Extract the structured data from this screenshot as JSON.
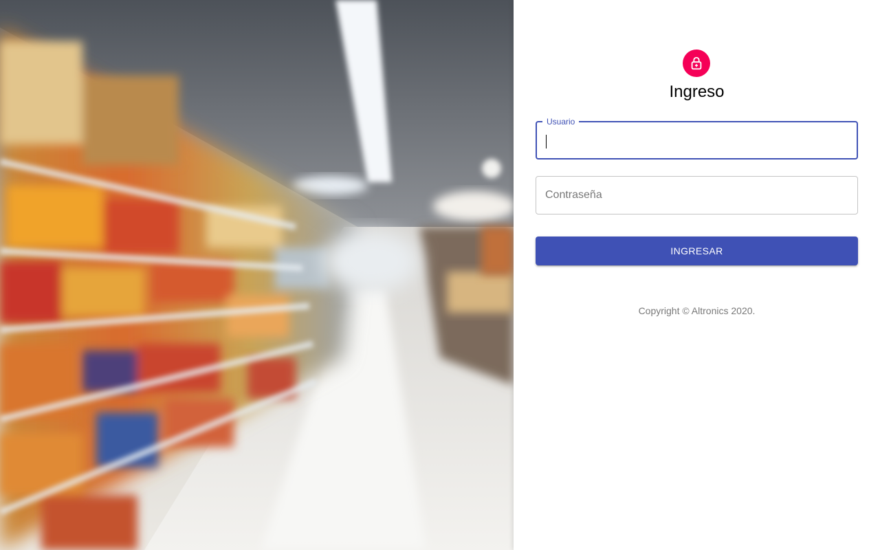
{
  "hero": {
    "image": "blurred-supermarket-aisle"
  },
  "login": {
    "icon": "lock-icon",
    "title": "Ingreso",
    "username": {
      "label": "Usuario",
      "value": ""
    },
    "password": {
      "placeholder": "Contraseña",
      "value": ""
    },
    "submit_label": "INGRESAR",
    "copyright": "Copyright © Altronics 2020."
  },
  "colors": {
    "accent": "#3f51b5",
    "avatar": "#f50057",
    "panel_bg": "#ffffff"
  }
}
